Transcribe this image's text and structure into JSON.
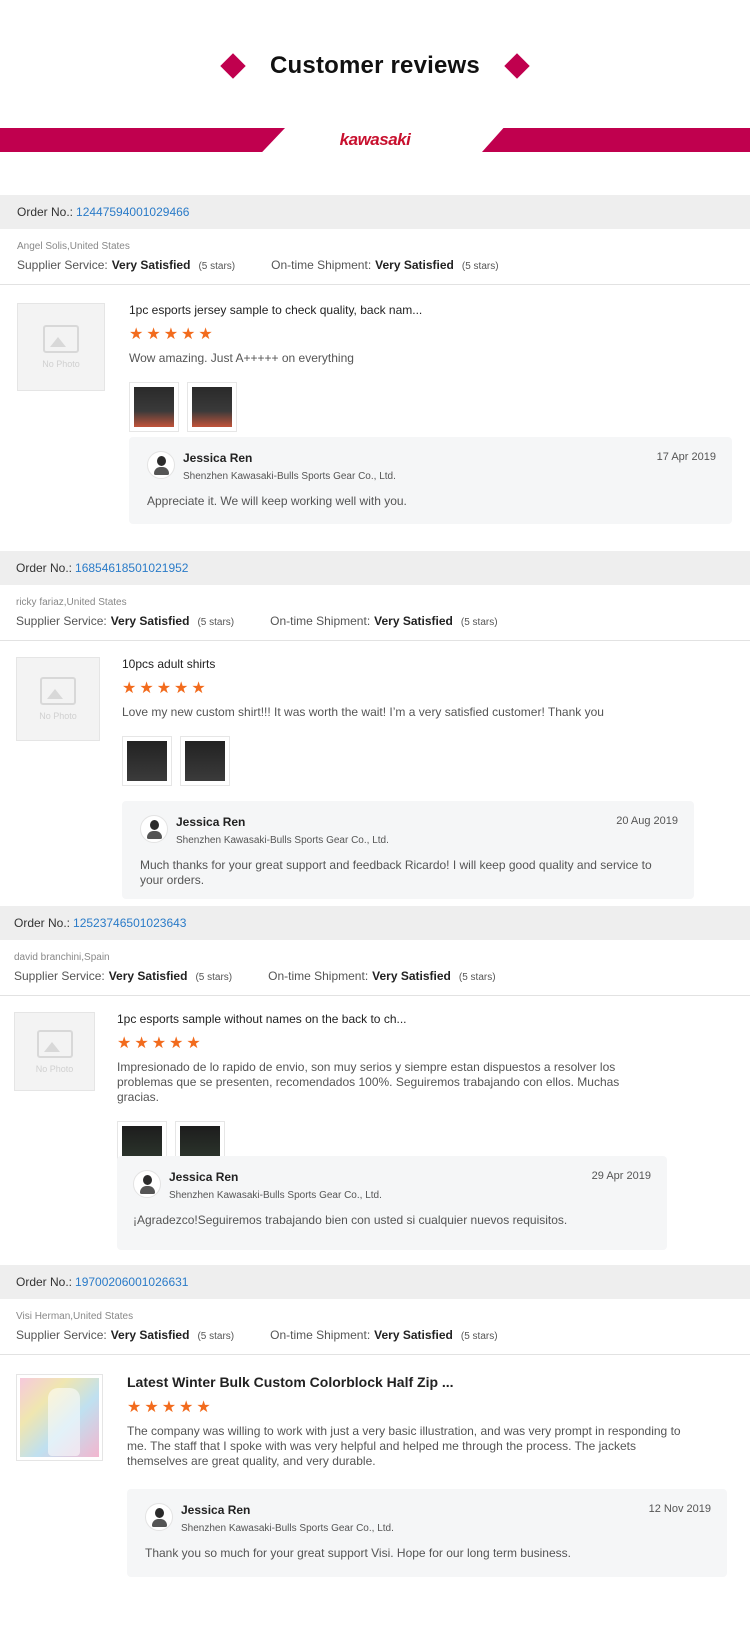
{
  "page": {
    "title": "Customer reviews",
    "brand": "kawasaki",
    "accent": "#c0004e",
    "star_color": "#f26b1d",
    "link_color": "#2a7bc8"
  },
  "labels": {
    "order_no": "Order No.:",
    "supplier_service": "Supplier Service:",
    "on_time_shipment": "On-time Shipment:",
    "no_photo": "No Photo"
  },
  "reviews": [
    {
      "order_no": "12447594001029466",
      "buyer": "Angel Solis,United States",
      "supplier_rating": "Very Satisfied",
      "supplier_stars": "(5 stars)",
      "shipment_rating": "Very Satisfied",
      "shipment_stars": "(5 stars)",
      "product_title": "1pc esports jersey sample to check quality, back nam...",
      "rating": 5,
      "comment": "Wow amazing. Just A+++++ on everything",
      "reply": {
        "name": "Jessica Ren",
        "company": "Shenzhen Kawasaki-Bulls Sports Gear Co., Ltd.",
        "date": "17 Apr 2019",
        "text": "Appreciate it. We will keep working well with you."
      }
    },
    {
      "order_no": "16854618501021952",
      "buyer": "ricky fariaz,United States",
      "supplier_rating": "Very Satisfied",
      "supplier_stars": "(5 stars)",
      "shipment_rating": "Very Satisfied",
      "shipment_stars": "(5 stars)",
      "product_title": "10pcs adult shirts",
      "rating": 5,
      "comment": "Love my new custom shirt!!! It was worth the wait! I’m a very satisfied customer! Thank you",
      "reply": {
        "name": "Jessica Ren",
        "company": "Shenzhen Kawasaki-Bulls Sports Gear Co., Ltd.",
        "date": "20 Aug 2019",
        "text": "Much thanks for your great support and feedback Ricardo! I will keep good quality and service to your orders."
      }
    },
    {
      "order_no": "12523746501023643",
      "buyer": "david branchini,Spain",
      "supplier_rating": "Very Satisfied",
      "supplier_stars": "(5 stars)",
      "shipment_rating": "Very Satisfied",
      "shipment_stars": "(5 stars)",
      "product_title": "1pc esports sample without names on the back to ch...",
      "rating": 5,
      "comment": "Impresionado de lo rapido de envio, son muy serios y siempre estan dispuestos a resolver los problemas que se presenten, recomendados 100%. Seguiremos trabajando con ellos. Muchas gracias.",
      "reply": {
        "name": "Jessica Ren",
        "company": "Shenzhen Kawasaki-Bulls Sports Gear Co., Ltd.",
        "date": "29 Apr 2019",
        "text": "¡Agradezco!Seguiremos trabajando bien con usted si cualquier nuevos requisitos."
      }
    },
    {
      "order_no": "19700206001026631",
      "buyer": "Visi Herman,United States",
      "supplier_rating": "Very Satisfied",
      "supplier_stars": "(5 stars)",
      "shipment_rating": "Very Satisfied",
      "shipment_stars": "(5 stars)",
      "product_title": "Latest Winter Bulk Custom Colorblock Half Zip ...",
      "rating": 5,
      "comment": "The company was willing to work with just a very basic illustration, and was very prompt in responding to me. The staff that I spoke with was very helpful and helped me through the process. The jackets themselves are great quality, and very durable.",
      "reply": {
        "name": "Jessica Ren",
        "company": "Shenzhen Kawasaki-Bulls Sports Gear Co., Ltd.",
        "date": "12 Nov 2019",
        "text": "Thank you so much for your great support Visi. Hope for our long term business."
      }
    }
  ]
}
